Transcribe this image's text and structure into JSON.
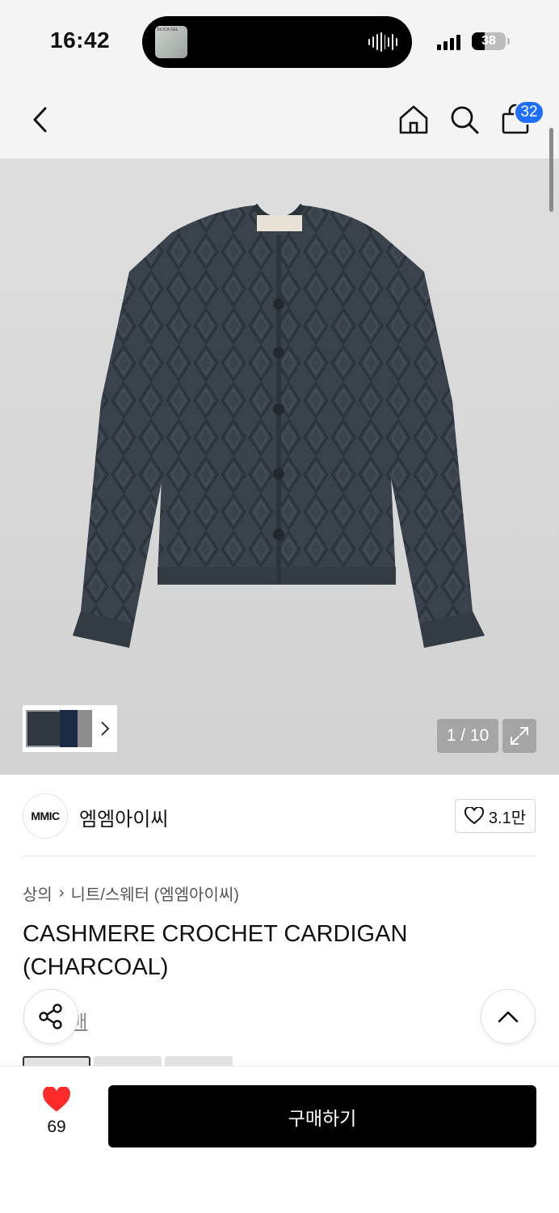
{
  "status_bar": {
    "time": "16:42",
    "battery": "38",
    "battery_level": 0.38,
    "now_playing_art_text": "SILICA GEL"
  },
  "nav": {
    "back_icon": "chevron-left-icon",
    "home_icon": "home-icon",
    "search_icon": "search-icon",
    "bag_icon": "shopping-bag-icon",
    "cart_count": "32"
  },
  "gallery": {
    "counter": "1 / 10",
    "expand_icon": "expand-icon",
    "image_desc_colors": {
      "cardigan": "#39424a",
      "background": "#d6d6d6"
    }
  },
  "brand": {
    "logo_text": "MMIC",
    "name": "엠엠아이씨",
    "likes": "3.1만"
  },
  "breadcrumb": {
    "category": "상의",
    "separator": "›",
    "subcategory": "니트/스웨터 (엠엠아이씨)"
  },
  "product": {
    "title": "CASHMERE CROCHET CARDIGAN (CHARCOAL)",
    "partial_link": "매"
  },
  "bottom": {
    "like_count": "69",
    "buy_label": "구매하기",
    "heart_color": "#ff2a2a"
  }
}
